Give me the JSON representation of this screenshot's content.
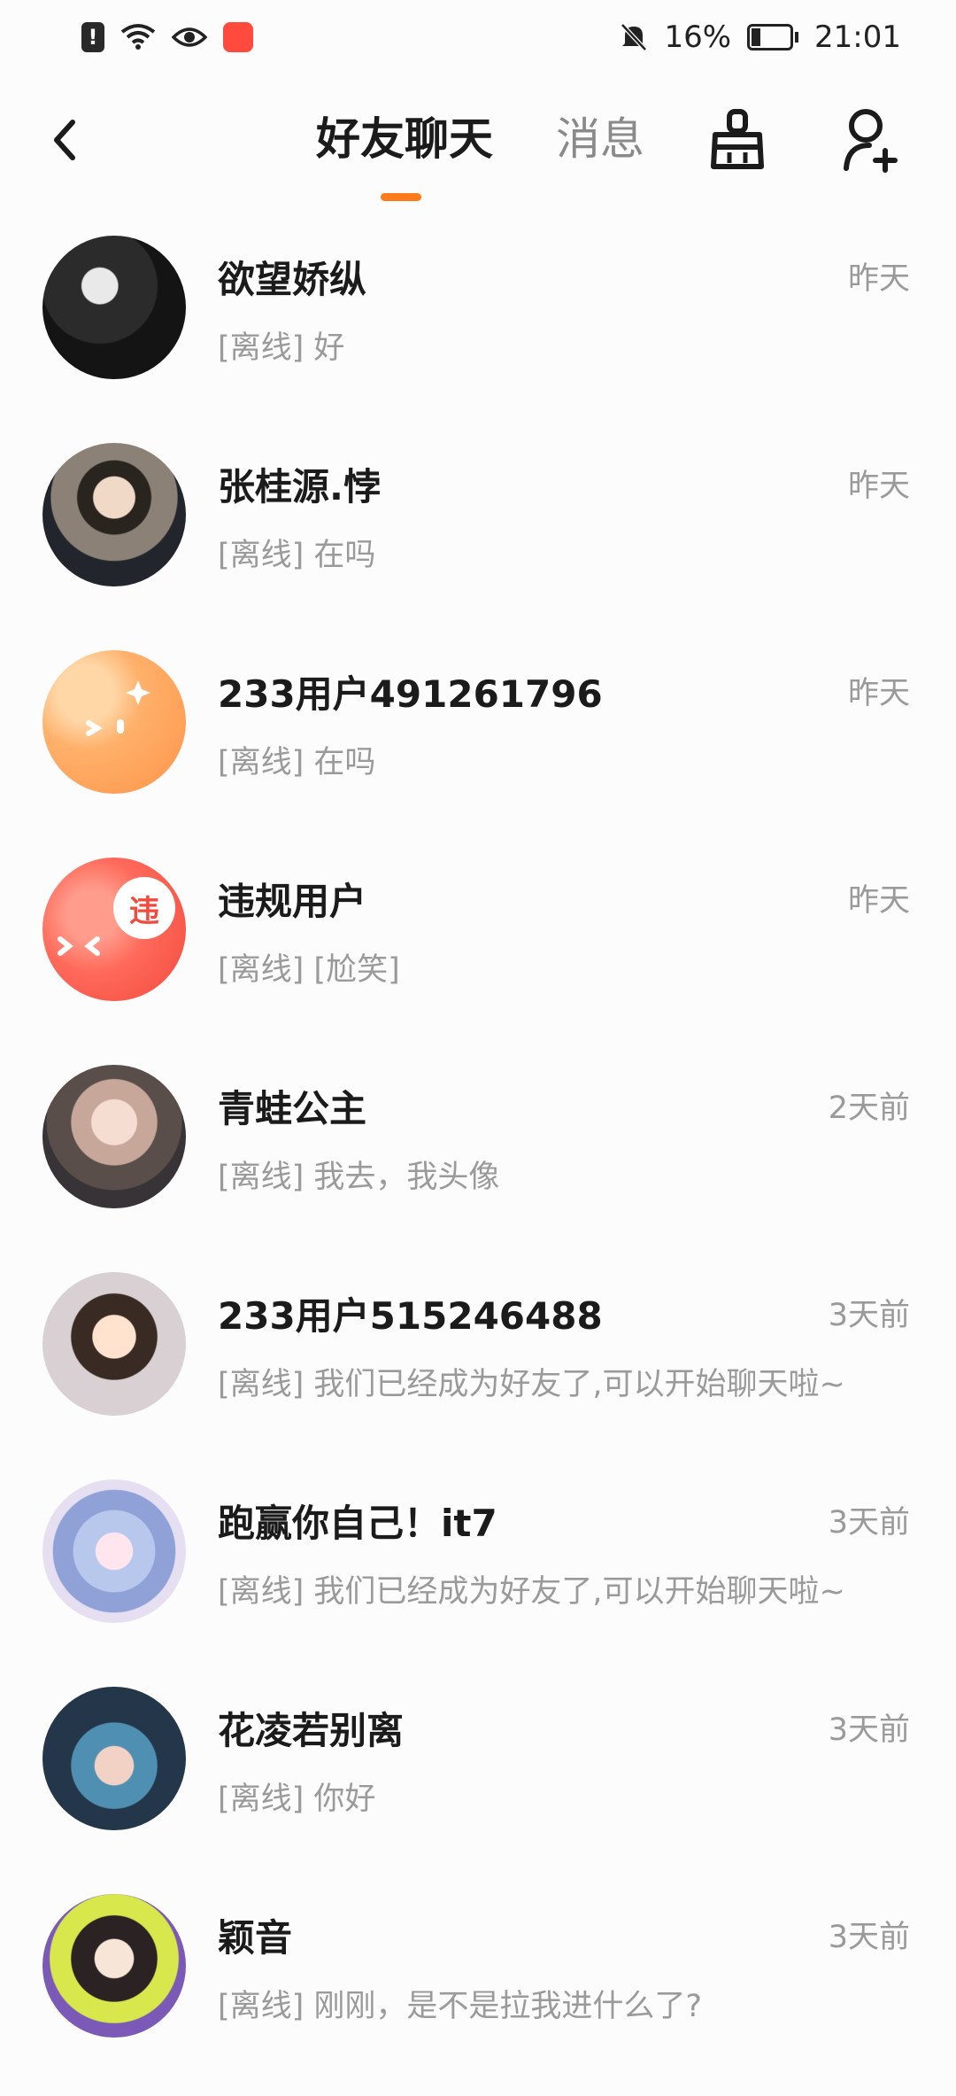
{
  "status_bar": {
    "battery": "16%",
    "time": "21:01",
    "warning_icon": "!",
    "app_icon": "app-icon"
  },
  "header": {
    "tabs": [
      {
        "label": "好友聊天",
        "active": true
      },
      {
        "label": "消息",
        "active": false
      }
    ],
    "accent": "#ff7a1a"
  },
  "chats": [
    {
      "name": "欲望娇纵",
      "preview": "[离线] 好",
      "time": "昨天"
    },
    {
      "name": "张桂源.悖",
      "preview": "[离线] 在吗",
      "time": "昨天"
    },
    {
      "name": "233用户491261796",
      "preview": "[离线] 在吗",
      "time": "昨天"
    },
    {
      "name": "违规用户",
      "preview": "[离线] [尬笑]",
      "time": "昨天",
      "badge": "违"
    },
    {
      "name": "青蛙公主",
      "preview": "[离线] 我去，我头像",
      "time": "2天前"
    },
    {
      "name": "233用户515246488",
      "preview": "[离线] 我们已经成为好友了,可以开始聊天啦~",
      "time": "3天前"
    },
    {
      "name": "跑赢你自己！it7",
      "preview": "[离线] 我们已经成为好友了,可以开始聊天啦~",
      "time": "3天前"
    },
    {
      "name": "花凌若别离",
      "preview": "[离线] 你好",
      "time": "3天前"
    },
    {
      "name": "颖音",
      "preview": "[离线] 刚刚，是不是拉我进什么了?",
      "time": "3天前"
    }
  ]
}
